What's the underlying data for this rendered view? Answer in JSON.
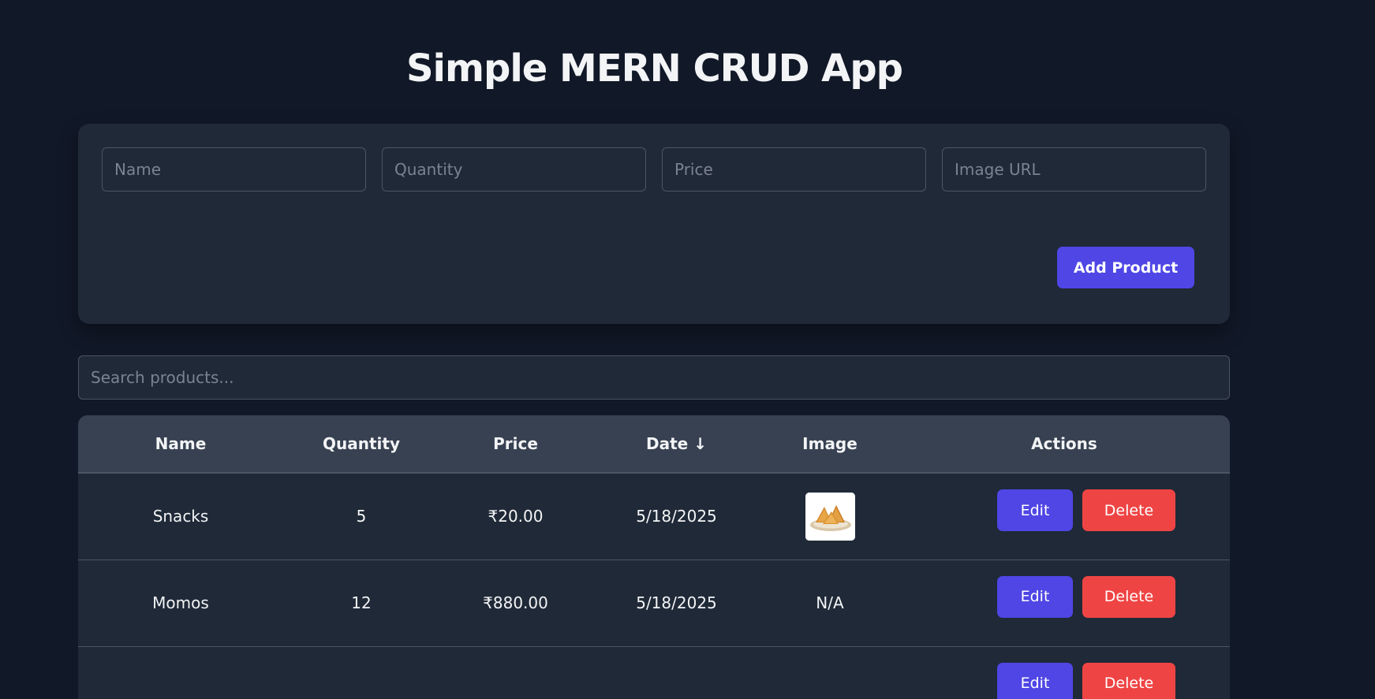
{
  "header": {
    "title": "Simple MERN CRUD App"
  },
  "form": {
    "name_placeholder": "Name",
    "quantity_placeholder": "Quantity",
    "price_placeholder": "Price",
    "image_url_placeholder": "Image URL",
    "name_value": "",
    "quantity_value": "",
    "price_value": "",
    "image_url_value": "",
    "add_button_label": "Add Product"
  },
  "search": {
    "placeholder": "Search products...",
    "value": ""
  },
  "table": {
    "columns": [
      "Name",
      "Quantity",
      "Price",
      "Date ↓",
      "Image",
      "Actions"
    ],
    "rows": [
      {
        "name": "Snacks",
        "quantity": "5",
        "price": "₹20.00",
        "date": "5/18/2025",
        "image": "samosa-thumbnail",
        "edit_label": "Edit",
        "delete_label": "Delete"
      },
      {
        "name": "Momos",
        "quantity": "12",
        "price": "₹880.00",
        "date": "5/18/2025",
        "image": "N/A",
        "edit_label": "Edit",
        "delete_label": "Delete"
      },
      {
        "name": "",
        "quantity": "",
        "price": "",
        "date": "",
        "image": "",
        "edit_label": "Edit",
        "delete_label": "Delete"
      }
    ]
  },
  "colors": {
    "background": "#111827",
    "card": "#1f2937",
    "header_row": "#374151",
    "primary": "#4f46e5",
    "danger": "#ef4444",
    "border": "#4b5563"
  }
}
